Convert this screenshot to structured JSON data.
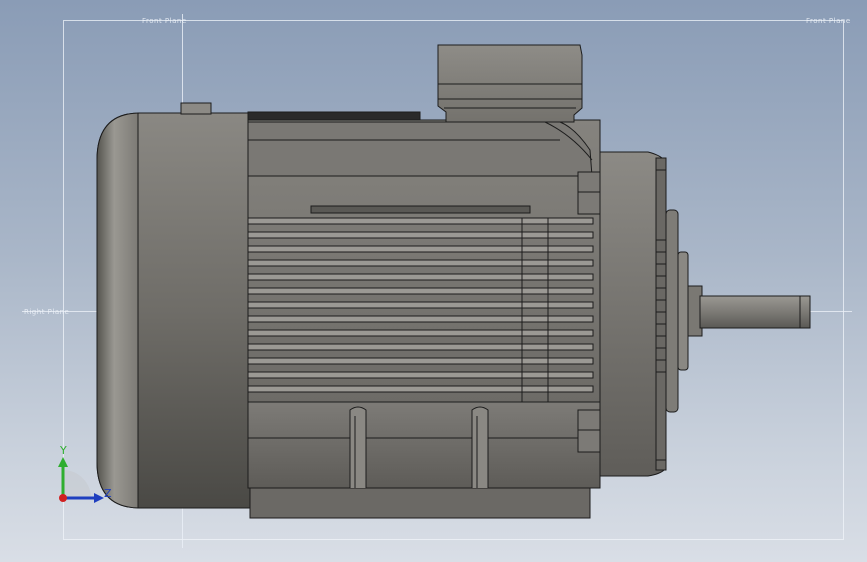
{
  "viewport": {
    "background_top": "#8a9cb6",
    "background_bottom": "#d9dee6"
  },
  "plane_labels": {
    "top_left": "Front Plane",
    "top_right": "Front Plane",
    "left_mid": "Right Plane"
  },
  "model": {
    "body_color": "#8d8b85",
    "outline_color": "#1c1c1c"
  },
  "triad": {
    "x_axis_color": "#2f8f2f",
    "y_label": "Y",
    "z_label": "Z",
    "y_color": "#2fae2f",
    "z_color": "#1f3fbf"
  }
}
